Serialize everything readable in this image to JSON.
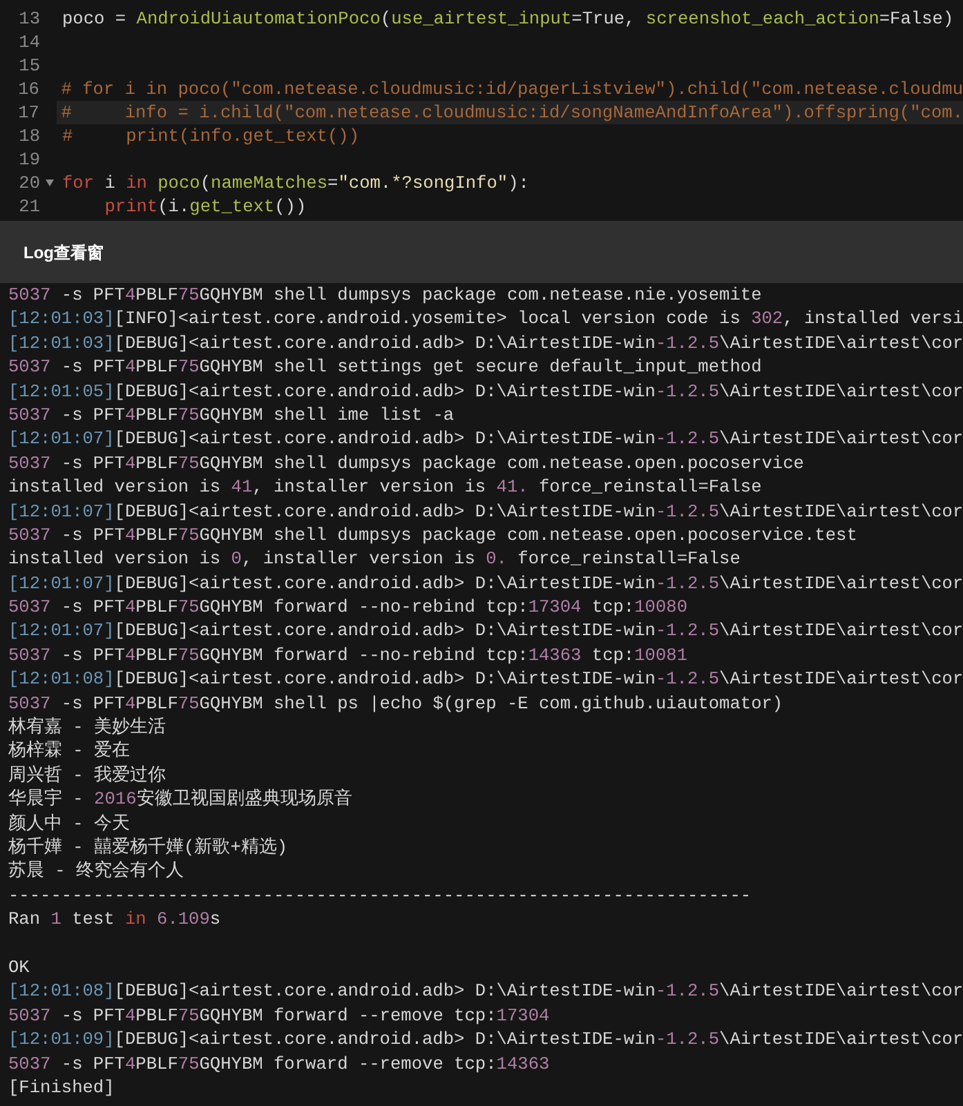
{
  "editor": {
    "lines": [
      {
        "number": "13",
        "highlighted": false,
        "foldable": false,
        "segments": [
          {
            "text": "poco = ",
            "kind": "plain"
          },
          {
            "text": "AndroidUiautomationPoco",
            "kind": "func"
          },
          {
            "text": "(",
            "kind": "plain"
          },
          {
            "text": "use_airtest_input",
            "kind": "func"
          },
          {
            "text": "=True, ",
            "kind": "plain"
          },
          {
            "text": "screenshot_each_action",
            "kind": "func"
          },
          {
            "text": "=False)",
            "kind": "plain"
          }
        ]
      },
      {
        "number": "14",
        "highlighted": false,
        "foldable": false
      },
      {
        "number": "15",
        "highlighted": false,
        "foldable": false
      },
      {
        "number": "16",
        "highlighted": false,
        "foldable": false,
        "segments": [
          {
            "text": "# for i in poco(\"com.netease.cloudmusic:id/pagerListview\").child(\"com.netease.cloudmu",
            "kind": "comment"
          }
        ]
      },
      {
        "number": "17",
        "highlighted": true,
        "foldable": false,
        "segments": [
          {
            "text": "#     info = i.child(\"com.netease.cloudmusic:id/songNameAndInfoArea\").offspring(\"com.",
            "kind": "comment"
          }
        ]
      },
      {
        "number": "18",
        "highlighted": false,
        "foldable": false,
        "segments": [
          {
            "text": "#     print(info.get_text())",
            "kind": "comment"
          }
        ]
      },
      {
        "number": "19",
        "highlighted": false,
        "foldable": false
      },
      {
        "number": "20",
        "highlighted": false,
        "foldable": true,
        "segments": [
          {
            "text": "for",
            "kind": "keyword"
          },
          {
            "text": " i ",
            "kind": "plain"
          },
          {
            "text": "in",
            "kind": "keyword"
          },
          {
            "text": " poco",
            "kind": "func"
          },
          {
            "text": "(",
            "kind": "plain"
          },
          {
            "text": "nameMatches",
            "kind": "func"
          },
          {
            "text": "=",
            "kind": "plain"
          },
          {
            "text": "\"com.*?songInfo\"",
            "kind": "string"
          },
          {
            "text": "):",
            "kind": "plain"
          }
        ]
      },
      {
        "number": "21",
        "highlighted": false,
        "foldable": false,
        "segments": [
          {
            "text": "    print",
            "kind": "keyword"
          },
          {
            "text": "(i.",
            "kind": "plain"
          },
          {
            "text": "get_text",
            "kind": "func"
          },
          {
            "text": "())",
            "kind": "plain"
          }
        ]
      }
    ]
  },
  "log_panel": {
    "title": "Log查看窗",
    "lines": [
      [
        {
          "text": "5037",
          "kind": "number"
        },
        {
          "text": " -s PFT",
          "kind": "plain"
        },
        {
          "text": "4",
          "kind": "number"
        },
        {
          "text": "PBLF",
          "kind": "plain"
        },
        {
          "text": "75",
          "kind": "number"
        },
        {
          "text": "GQHYBM shell dumpsys package com.netease.nie.yosemite",
          "kind": "plain"
        }
      ],
      [
        {
          "text": "[12:01:03]",
          "kind": "time"
        },
        {
          "text": "[INFO]<airtest.core.android.yosemite> local version code is ",
          "kind": "plain"
        },
        {
          "text": "302",
          "kind": "number"
        },
        {
          "text": ", installed versi",
          "kind": "plain"
        }
      ],
      [
        {
          "text": "[12:01:03]",
          "kind": "time"
        },
        {
          "text": "[DEBUG]<airtest.core.android.adb> D:\\AirtestIDE-win",
          "kind": "plain"
        },
        {
          "text": "-1.2.5",
          "kind": "number"
        },
        {
          "text": "\\AirtestIDE\\airtest\\cor",
          "kind": "plain"
        }
      ],
      [
        {
          "text": "5037",
          "kind": "number"
        },
        {
          "text": " -s PFT",
          "kind": "plain"
        },
        {
          "text": "4",
          "kind": "number"
        },
        {
          "text": "PBLF",
          "kind": "plain"
        },
        {
          "text": "75",
          "kind": "number"
        },
        {
          "text": "GQHYBM shell settings get secure default_input_method",
          "kind": "plain"
        }
      ],
      [
        {
          "text": "[12:01:05]",
          "kind": "time"
        },
        {
          "text": "[DEBUG]<airtest.core.android.adb> D:\\AirtestIDE-win",
          "kind": "plain"
        },
        {
          "text": "-1.2.5",
          "kind": "number"
        },
        {
          "text": "\\AirtestIDE\\airtest\\cor",
          "kind": "plain"
        }
      ],
      [
        {
          "text": "5037",
          "kind": "number"
        },
        {
          "text": " -s PFT",
          "kind": "plain"
        },
        {
          "text": "4",
          "kind": "number"
        },
        {
          "text": "PBLF",
          "kind": "plain"
        },
        {
          "text": "75",
          "kind": "number"
        },
        {
          "text": "GQHYBM shell ime list -a",
          "kind": "plain"
        }
      ],
      [
        {
          "text": "[12:01:07]",
          "kind": "time"
        },
        {
          "text": "[DEBUG]<airtest.core.android.adb> D:\\AirtestIDE-win",
          "kind": "plain"
        },
        {
          "text": "-1.2.5",
          "kind": "number"
        },
        {
          "text": "\\AirtestIDE\\airtest\\cor",
          "kind": "plain"
        }
      ],
      [
        {
          "text": "5037",
          "kind": "number"
        },
        {
          "text": " -s PFT",
          "kind": "plain"
        },
        {
          "text": "4",
          "kind": "number"
        },
        {
          "text": "PBLF",
          "kind": "plain"
        },
        {
          "text": "75",
          "kind": "number"
        },
        {
          "text": "GQHYBM shell dumpsys package com.netease.open.pocoservice",
          "kind": "plain"
        }
      ],
      [
        {
          "text": "installed version is ",
          "kind": "plain"
        },
        {
          "text": "41",
          "kind": "number"
        },
        {
          "text": ", installer version is ",
          "kind": "plain"
        },
        {
          "text": "41.",
          "kind": "number"
        },
        {
          "text": " force_reinstall=False",
          "kind": "plain"
        }
      ],
      [
        {
          "text": "[12:01:07]",
          "kind": "time"
        },
        {
          "text": "[DEBUG]<airtest.core.android.adb> D:\\AirtestIDE-win",
          "kind": "plain"
        },
        {
          "text": "-1.2.5",
          "kind": "number"
        },
        {
          "text": "\\AirtestIDE\\airtest\\cor",
          "kind": "plain"
        }
      ],
      [
        {
          "text": "5037",
          "kind": "number"
        },
        {
          "text": " -s PFT",
          "kind": "plain"
        },
        {
          "text": "4",
          "kind": "number"
        },
        {
          "text": "PBLF",
          "kind": "plain"
        },
        {
          "text": "75",
          "kind": "number"
        },
        {
          "text": "GQHYBM shell dumpsys package com.netease.open.pocoservice.test",
          "kind": "plain"
        }
      ],
      [
        {
          "text": "installed version is ",
          "kind": "plain"
        },
        {
          "text": "0",
          "kind": "number"
        },
        {
          "text": ", installer version is ",
          "kind": "plain"
        },
        {
          "text": "0.",
          "kind": "number"
        },
        {
          "text": " force_reinstall=False",
          "kind": "plain"
        }
      ],
      [
        {
          "text": "[12:01:07]",
          "kind": "time"
        },
        {
          "text": "[DEBUG]<airtest.core.android.adb> D:\\AirtestIDE-win",
          "kind": "plain"
        },
        {
          "text": "-1.2.5",
          "kind": "number"
        },
        {
          "text": "\\AirtestIDE\\airtest\\cor",
          "kind": "plain"
        }
      ],
      [
        {
          "text": "5037",
          "kind": "number"
        },
        {
          "text": " -s PFT",
          "kind": "plain"
        },
        {
          "text": "4",
          "kind": "number"
        },
        {
          "text": "PBLF",
          "kind": "plain"
        },
        {
          "text": "75",
          "kind": "number"
        },
        {
          "text": "GQHYBM forward --no-rebind tcp:",
          "kind": "plain"
        },
        {
          "text": "17304",
          "kind": "number"
        },
        {
          "text": " tcp:",
          "kind": "plain"
        },
        {
          "text": "10080",
          "kind": "number"
        }
      ],
      [
        {
          "text": "[12:01:07]",
          "kind": "time"
        },
        {
          "text": "[DEBUG]<airtest.core.android.adb> D:\\AirtestIDE-win",
          "kind": "plain"
        },
        {
          "text": "-1.2.5",
          "kind": "number"
        },
        {
          "text": "\\AirtestIDE\\airtest\\cor",
          "kind": "plain"
        }
      ],
      [
        {
          "text": "5037",
          "kind": "number"
        },
        {
          "text": " -s PFT",
          "kind": "plain"
        },
        {
          "text": "4",
          "kind": "number"
        },
        {
          "text": "PBLF",
          "kind": "plain"
        },
        {
          "text": "75",
          "kind": "number"
        },
        {
          "text": "GQHYBM forward --no-rebind tcp:",
          "kind": "plain"
        },
        {
          "text": "14363",
          "kind": "number"
        },
        {
          "text": " tcp:",
          "kind": "plain"
        },
        {
          "text": "10081",
          "kind": "number"
        }
      ],
      [
        {
          "text": "[12:01:08]",
          "kind": "time"
        },
        {
          "text": "[DEBUG]<airtest.core.android.adb> D:\\AirtestIDE-win",
          "kind": "plain"
        },
        {
          "text": "-1.2.5",
          "kind": "number"
        },
        {
          "text": "\\AirtestIDE\\airtest\\cor",
          "kind": "plain"
        }
      ],
      [
        {
          "text": "5037",
          "kind": "number"
        },
        {
          "text": " -s PFT",
          "kind": "plain"
        },
        {
          "text": "4",
          "kind": "number"
        },
        {
          "text": "PBLF",
          "kind": "plain"
        },
        {
          "text": "75",
          "kind": "number"
        },
        {
          "text": "GQHYBM shell ps |echo $(grep -E com.github.uiautomator)",
          "kind": "plain"
        }
      ],
      [
        {
          "text": "林宥嘉 - 美妙生活",
          "kind": "plain"
        }
      ],
      [
        {
          "text": "杨梓霖 - 爱在",
          "kind": "plain"
        }
      ],
      [
        {
          "text": "周兴哲 - 我爱过你",
          "kind": "plain"
        }
      ],
      [
        {
          "text": "华晨宇 - ",
          "kind": "plain"
        },
        {
          "text": "2016",
          "kind": "number"
        },
        {
          "text": "安徽卫视国剧盛典现场原音",
          "kind": "plain"
        }
      ],
      [
        {
          "text": "颜人中 - 今天",
          "kind": "plain"
        }
      ],
      [
        {
          "text": "杨千嬅 - 囍爱杨千嬅(新歌+精选)",
          "kind": "plain"
        }
      ],
      [
        {
          "text": "苏晨 - 终究会有个人",
          "kind": "plain"
        }
      ],
      [
        {
          "text": "----------------------------------------------------------------------",
          "kind": "plain"
        }
      ],
      [
        {
          "text": "Ran ",
          "kind": "plain"
        },
        {
          "text": "1",
          "kind": "number"
        },
        {
          "text": " test ",
          "kind": "plain"
        },
        {
          "text": "in",
          "kind": "keyword"
        },
        {
          "text": " 6.109",
          "kind": "number"
        },
        {
          "text": "s",
          "kind": "plain"
        }
      ],
      {
        "kind": "blank"
      },
      [
        {
          "text": "OK",
          "kind": "plain"
        }
      ],
      [
        {
          "text": "[12:01:08]",
          "kind": "time"
        },
        {
          "text": "[DEBUG]<airtest.core.android.adb> D:\\AirtestIDE-win",
          "kind": "plain"
        },
        {
          "text": "-1.2.5",
          "kind": "number"
        },
        {
          "text": "\\AirtestIDE\\airtest\\cor",
          "kind": "plain"
        }
      ],
      [
        {
          "text": "5037",
          "kind": "number"
        },
        {
          "text": " -s PFT",
          "kind": "plain"
        },
        {
          "text": "4",
          "kind": "number"
        },
        {
          "text": "PBLF",
          "kind": "plain"
        },
        {
          "text": "75",
          "kind": "number"
        },
        {
          "text": "GQHYBM forward --remove tcp:",
          "kind": "plain"
        },
        {
          "text": "17304",
          "kind": "number"
        }
      ],
      [
        {
          "text": "[12:01:09]",
          "kind": "time"
        },
        {
          "text": "[DEBUG]<airtest.core.android.adb> D:\\AirtestIDE-win",
          "kind": "plain"
        },
        {
          "text": "-1.2.5",
          "kind": "number"
        },
        {
          "text": "\\AirtestIDE\\airtest\\cor",
          "kind": "plain"
        }
      ],
      [
        {
          "text": "5037",
          "kind": "number"
        },
        {
          "text": " -s PFT",
          "kind": "plain"
        },
        {
          "text": "4",
          "kind": "number"
        },
        {
          "text": "PBLF",
          "kind": "plain"
        },
        {
          "text": "75",
          "kind": "number"
        },
        {
          "text": "GQHYBM forward --remove tcp:",
          "kind": "plain"
        },
        {
          "text": "14363",
          "kind": "number"
        }
      ],
      [
        {
          "text": "[Finished]",
          "kind": "plain"
        }
      ]
    ]
  }
}
